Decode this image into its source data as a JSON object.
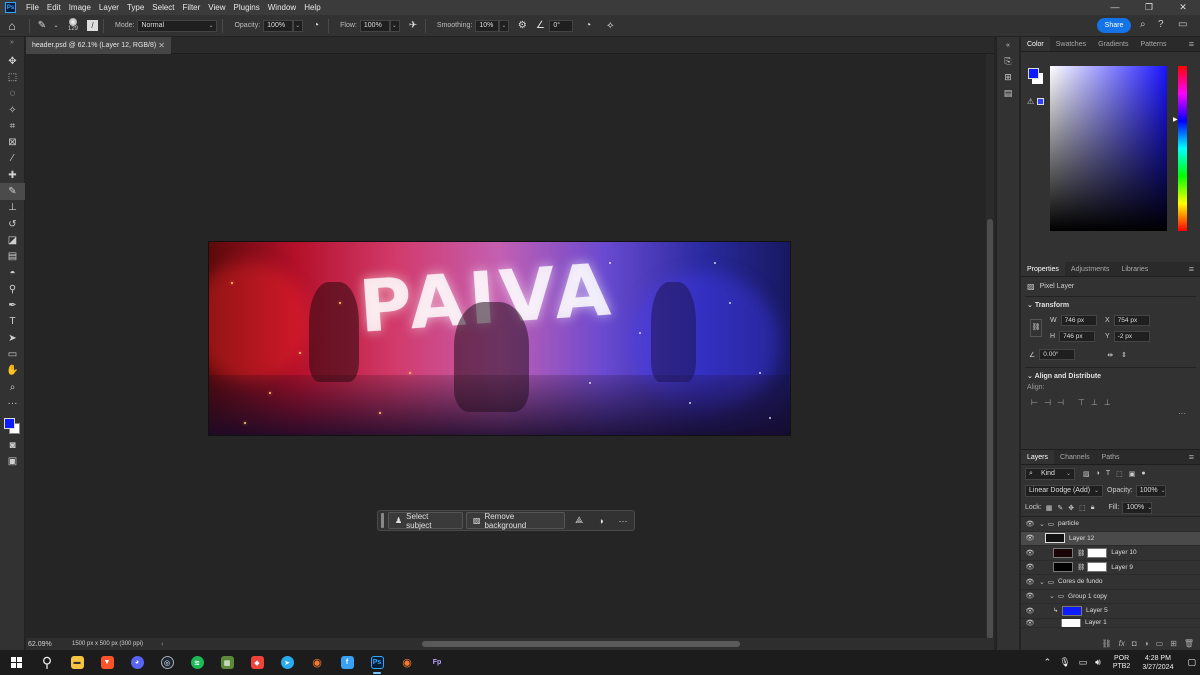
{
  "menubar": {
    "logo": "Ps",
    "items": [
      "File",
      "Edit",
      "Image",
      "Layer",
      "Type",
      "Select",
      "Filter",
      "View",
      "Plugins",
      "Window",
      "Help"
    ],
    "window_controls": [
      "—",
      "❐",
      "✕"
    ]
  },
  "options_bar": {
    "brush_size": "129",
    "mode_label": "Mode:",
    "mode_value": "Normal",
    "opacity_label": "Opacity:",
    "opacity_value": "100%",
    "flow_label": "Flow:",
    "flow_value": "100%",
    "smoothing_label": "Smoothing:",
    "smoothing_value": "10%",
    "angle_value": "0°",
    "share_label": "Share"
  },
  "document": {
    "tab_title": "header.psd @ 62.1% (Layer 12, RGB/8)",
    "artwork_text": "PAIVA"
  },
  "context_bar": {
    "select_subject": "Select subject",
    "remove_background": "Remove background"
  },
  "status": {
    "zoom": "62.09%",
    "info": "1500 px x 500 px (300 ppi)"
  },
  "color_panel": {
    "tabs": [
      "Color",
      "Swatches",
      "Gradients",
      "Patterns"
    ],
    "foreground": "#0d1bff",
    "background": "#ffffff"
  },
  "properties_panel": {
    "tabs": [
      "Properties",
      "Adjustments",
      "Libraries"
    ],
    "kind": "Pixel Layer",
    "transform_label": "Transform",
    "w_label": "W",
    "w_value": "746 px",
    "h_label": "H",
    "h_value": "746 px",
    "x_label": "X",
    "x_value": "754 px",
    "y_label": "Y",
    "y_value": "-2 px",
    "angle_value": "0.00°",
    "align_label": "Align and Distribute",
    "align_sub": "Align:"
  },
  "layers_panel": {
    "tabs": [
      "Layers",
      "Channels",
      "Paths"
    ],
    "filter_kind": "Kind",
    "blend_mode": "Linear Dodge (Add)",
    "opacity_label": "Opacity:",
    "opacity_value": "100%",
    "lock_label": "Lock:",
    "fill_label": "Fill:",
    "fill_value": "100%",
    "layers": [
      {
        "name": "particle",
        "type": "group"
      },
      {
        "name": "Layer 12",
        "type": "layer",
        "selected": true
      },
      {
        "name": "Layer 10",
        "type": "layer"
      },
      {
        "name": "Layer 9",
        "type": "layer"
      },
      {
        "name": "Cores de fundo",
        "type": "group"
      },
      {
        "name": "Group 1 copy",
        "type": "group"
      },
      {
        "name": "Layer 5",
        "type": "layer"
      },
      {
        "name": "Layer 1",
        "type": "layer"
      }
    ]
  },
  "taskbar": {
    "lang_top": "POR",
    "lang_bottom": "PTB2",
    "time": "4:28 PM",
    "date": "3/27/2024",
    "apps": [
      "Windows",
      "Search",
      "File Explorer",
      "Brave",
      "Discord",
      "Steam",
      "Spotify",
      "Minecraft",
      "AnyDesk",
      "Telegram",
      "Blender",
      "Store",
      "Photoshop",
      "Blender",
      "FilmoraPro"
    ]
  }
}
